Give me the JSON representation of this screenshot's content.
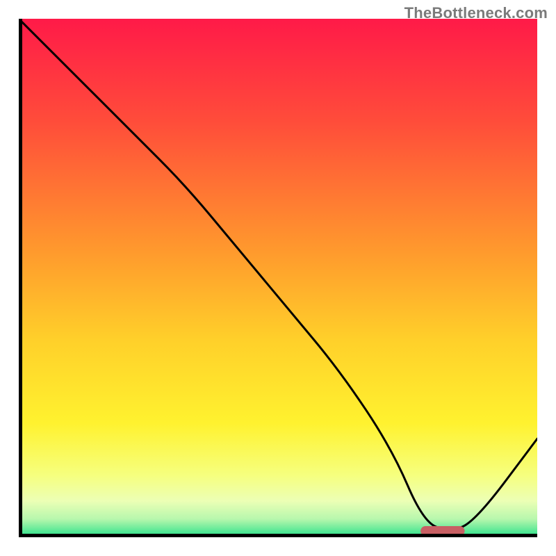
{
  "branding": {
    "text": "TheBottleneck.com"
  },
  "chart_data": {
    "type": "line",
    "title": "",
    "xlabel": "",
    "ylabel": "",
    "xlim": [
      0,
      100
    ],
    "ylim": [
      0,
      100
    ],
    "grid": false,
    "series": [
      {
        "name": "bottleneck-curve",
        "x": [
          0,
          10,
          22,
          32,
          42,
          52,
          62,
          72,
          78,
          83,
          88,
          100
        ],
        "y": [
          100,
          90,
          78,
          68,
          56,
          44,
          32,
          17,
          3,
          1,
          3,
          19
        ]
      }
    ],
    "marker": {
      "name": "optimal-range",
      "x_start": 77.5,
      "x_end": 86,
      "y": 1.2,
      "color": "#c86064"
    },
    "gradient_stops": [
      {
        "offset": 0.0,
        "color": "#ff1a48"
      },
      {
        "offset": 0.2,
        "color": "#ff4d3a"
      },
      {
        "offset": 0.45,
        "color": "#ff9a2d"
      },
      {
        "offset": 0.62,
        "color": "#ffd02a"
      },
      {
        "offset": 0.78,
        "color": "#fff22f"
      },
      {
        "offset": 0.88,
        "color": "#f6ff7e"
      },
      {
        "offset": 0.93,
        "color": "#ecffb5"
      },
      {
        "offset": 0.965,
        "color": "#b7f7ad"
      },
      {
        "offset": 1.0,
        "color": "#26e08a"
      }
    ],
    "axis": {
      "stroke": "#000000",
      "width": 5
    }
  }
}
